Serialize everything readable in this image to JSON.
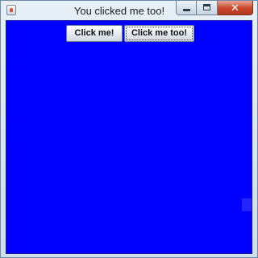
{
  "window": {
    "title": "You clicked me too!",
    "icon": "java-app-icon"
  },
  "controls": {
    "minimize_icon": "minimize-icon",
    "maximize_icon": "maximize-icon",
    "close_icon": "close-icon",
    "close_glyph": "✕"
  },
  "content": {
    "background_color": "#0000ff",
    "buttons": [
      {
        "label": "Click me!"
      },
      {
        "label": "Click me too!"
      }
    ]
  }
}
